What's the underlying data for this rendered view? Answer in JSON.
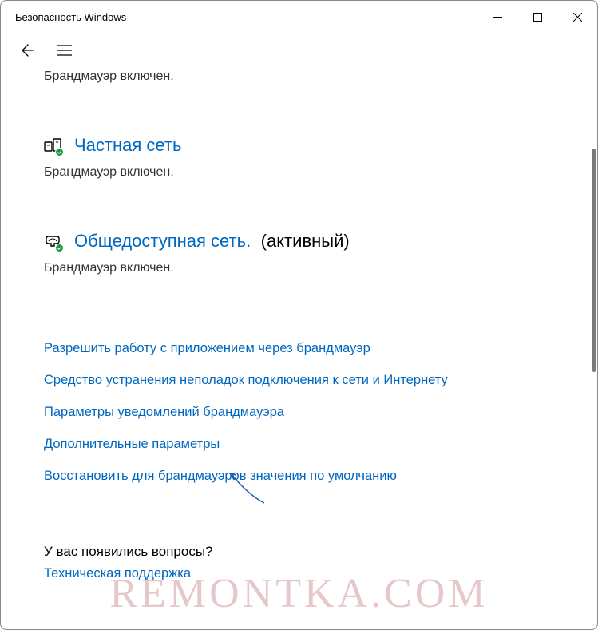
{
  "window": {
    "title": "Безопасность Windows"
  },
  "top_status": "Брандмауэр включен.",
  "private_network": {
    "title": "Частная сеть",
    "status": "Брандмауэр включен."
  },
  "public_network": {
    "title": "Общедоступная сеть.",
    "suffix": "(активный)",
    "status": "Брандмауэр включен."
  },
  "links": {
    "allow_app": "Разрешить работу с приложением через брандмауэр",
    "troubleshoot": "Средство устранения неполадок подключения к сети и Интернету",
    "notifications": "Параметры уведомлений брандмауэра",
    "advanced": "Дополнительные параметры",
    "restore": "Восстановить для брандмауэров значения по умолчанию"
  },
  "questions": {
    "heading": "У вас появились вопросы?",
    "support_link": "Техническая поддержка"
  },
  "watermark": "REMONTKA.COM"
}
